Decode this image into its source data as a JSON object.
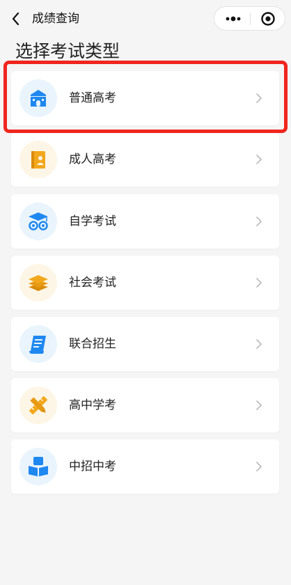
{
  "nav": {
    "title": "成绩查询"
  },
  "page": {
    "title": "选择考试类型"
  },
  "colors": {
    "highlight": "#f0261e",
    "blue": "#1e88f0",
    "orange": "#f2a81c"
  },
  "exam_types": [
    {
      "label": "普通高考",
      "icon": "school-building-icon"
    },
    {
      "label": "成人高考",
      "icon": "book-person-icon"
    },
    {
      "label": "自学考试",
      "icon": "graduation-cap-icon"
    },
    {
      "label": "社会考试",
      "icon": "layers-icon"
    },
    {
      "label": "联合招生",
      "icon": "scroll-icon"
    },
    {
      "label": "高中学考",
      "icon": "pencil-ruler-icon"
    },
    {
      "label": "中招中考",
      "icon": "reading-person-icon"
    }
  ]
}
